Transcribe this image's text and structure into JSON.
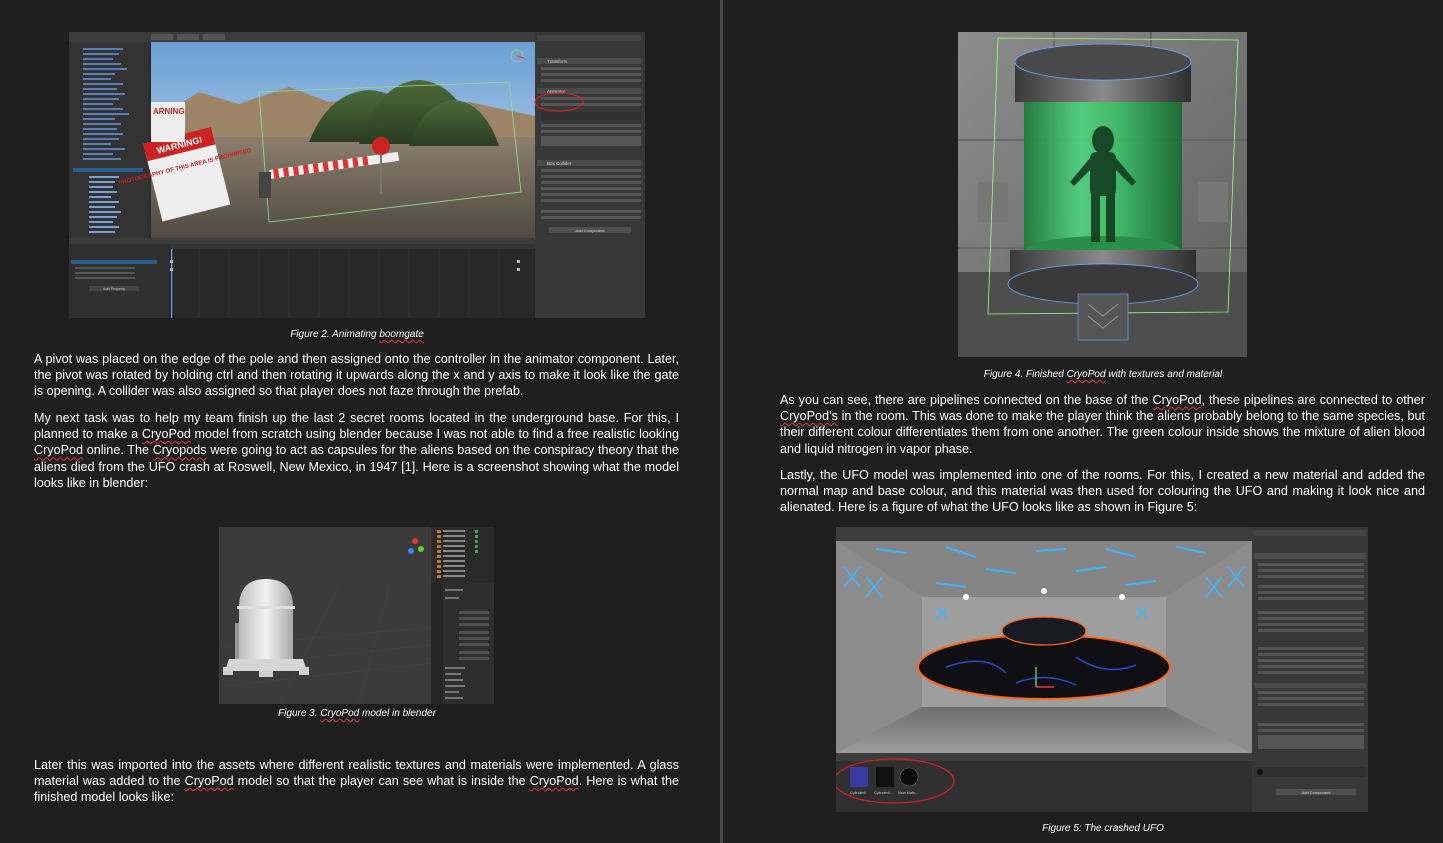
{
  "left": {
    "figure2_caption_pre": "Figure 2. Animating ",
    "figure2_caption_word": "boomgate",
    "para1": "A pivot was placed on the edge of the pole and then assigned onto the controller in the animator component. Later, the pivot was rotated by holding ctrl and then rotating it upwards along the x and y axis to make it look like the gate is opening. A collider was also assigned so that player does not faze through the prefab.",
    "para2_a": "My next task was to help my team finish up the last 2 secret rooms located in the underground base. For this, I planned to make a ",
    "para2_w1": "CryoPod",
    "para2_b": " model from scratch using blender because I was not able to find a free realistic looking ",
    "para2_w2": "CryoPod",
    "para2_c": " online. The ",
    "para2_w3": "Cryopods",
    "para2_d": " were going to act as capsules for the aliens based on the conspiracy theory that the aliens died from the UFO crash at Roswell, New Mexico, in 1947 [1].  Here is a screenshot showing what the model looks like in blender:",
    "figure3_caption_pre": "Figure 3. ",
    "figure3_caption_word": "CryoPod",
    "figure3_caption_post": " model in blender",
    "para3_a": "Later this was imported into the assets where different realistic textures and materials were implemented. A glass material was added to the ",
    "para3_w1": "CryoPod",
    "para3_b": " model so that the player can see what is inside the ",
    "para3_w2": "CryoPod",
    "para3_c": ". Here is what the finished model looks like:"
  },
  "right": {
    "figure4_caption_pre": "Figure 4. Finished ",
    "figure4_caption_word": "CryoPod",
    "figure4_caption_post": " with textures and material",
    "para4_a": "As you can see, there are pipelines connected on the base of the ",
    "para4_w1": "CryoPod",
    "para4_b": ", these pipelines are connected to other ",
    "para4_w2": "CryoPod’s",
    "para4_c": " in the room. This was done to make the player think the aliens probably belong to the same species, but their different colour differentiates them from one another. The green colour inside shows the mixture of alien blood and liquid nitrogen in vapor phase.",
    "para5": "Lastly, the UFO model was implemented into one of the rooms. For this, I created a new material and added the normal map and base colour, and this material was then used for colouring the UFO and making it look nice and alienated. Here is a figure of what the UFO looks like as shown in Figure 5:",
    "figure5_caption": "Figure 5: The crashed UFO"
  },
  "screenshot_text": {
    "sign_warning": "WARNING!",
    "sign_photo": "PHOTOGRAPHY OF THIS AREA IS PROHIBITED",
    "sign_arning": "ARNING",
    "add_component": "Add Component",
    "add_property": "Add Property",
    "transform": "Transform",
    "animator": "Animator",
    "box_collider": "Box Collider",
    "asset_cylinder": "Cylinder0",
    "asset_cylinder2": "Cylinder0...",
    "asset_new_mat": "New Mate..."
  },
  "colors": {
    "page_bg": "#1f1f1f",
    "divider": "#4a4a4a",
    "spell_underline": "#e23b3b",
    "unity_panel": "#383838",
    "cryo_green": "#39c46a",
    "ufo_orange": "#ff6a1a",
    "light_blue": "#3fb4ff"
  }
}
